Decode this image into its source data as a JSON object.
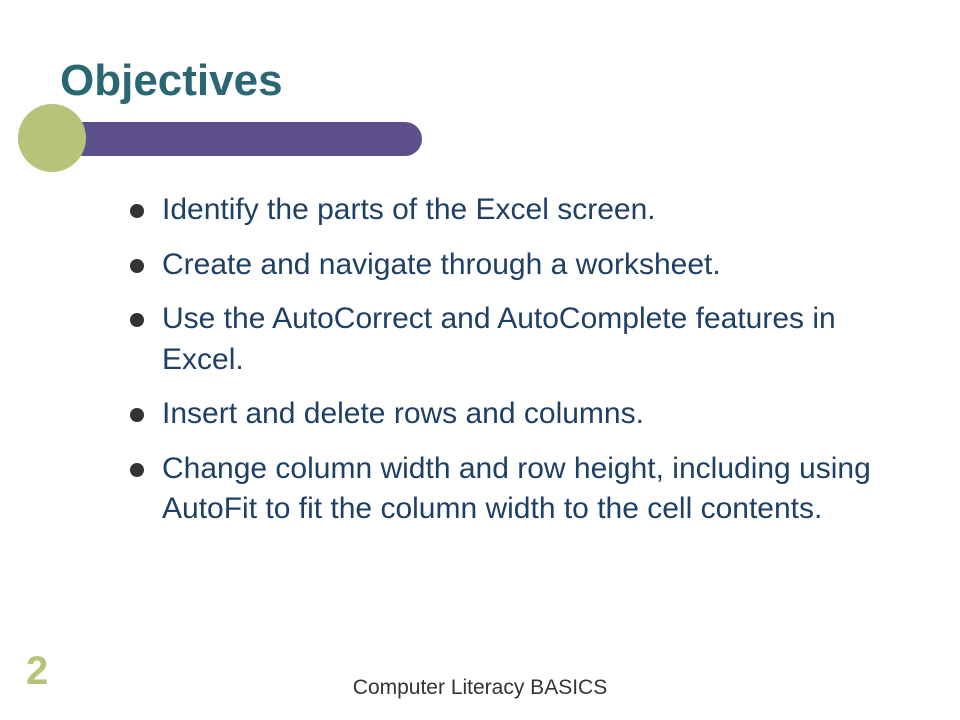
{
  "title": "Objectives",
  "bullets": [
    "Identify the parts of the Excel screen.",
    "Create and navigate through a worksheet.",
    "Use the AutoCorrect and AutoComplete features in Excel.",
    "Insert and delete rows and columns.",
    "Change column width and row height, including using AutoFit to fit the column width to the cell contents."
  ],
  "pageNumber": "2",
  "footer": "Computer Literacy BASICS"
}
